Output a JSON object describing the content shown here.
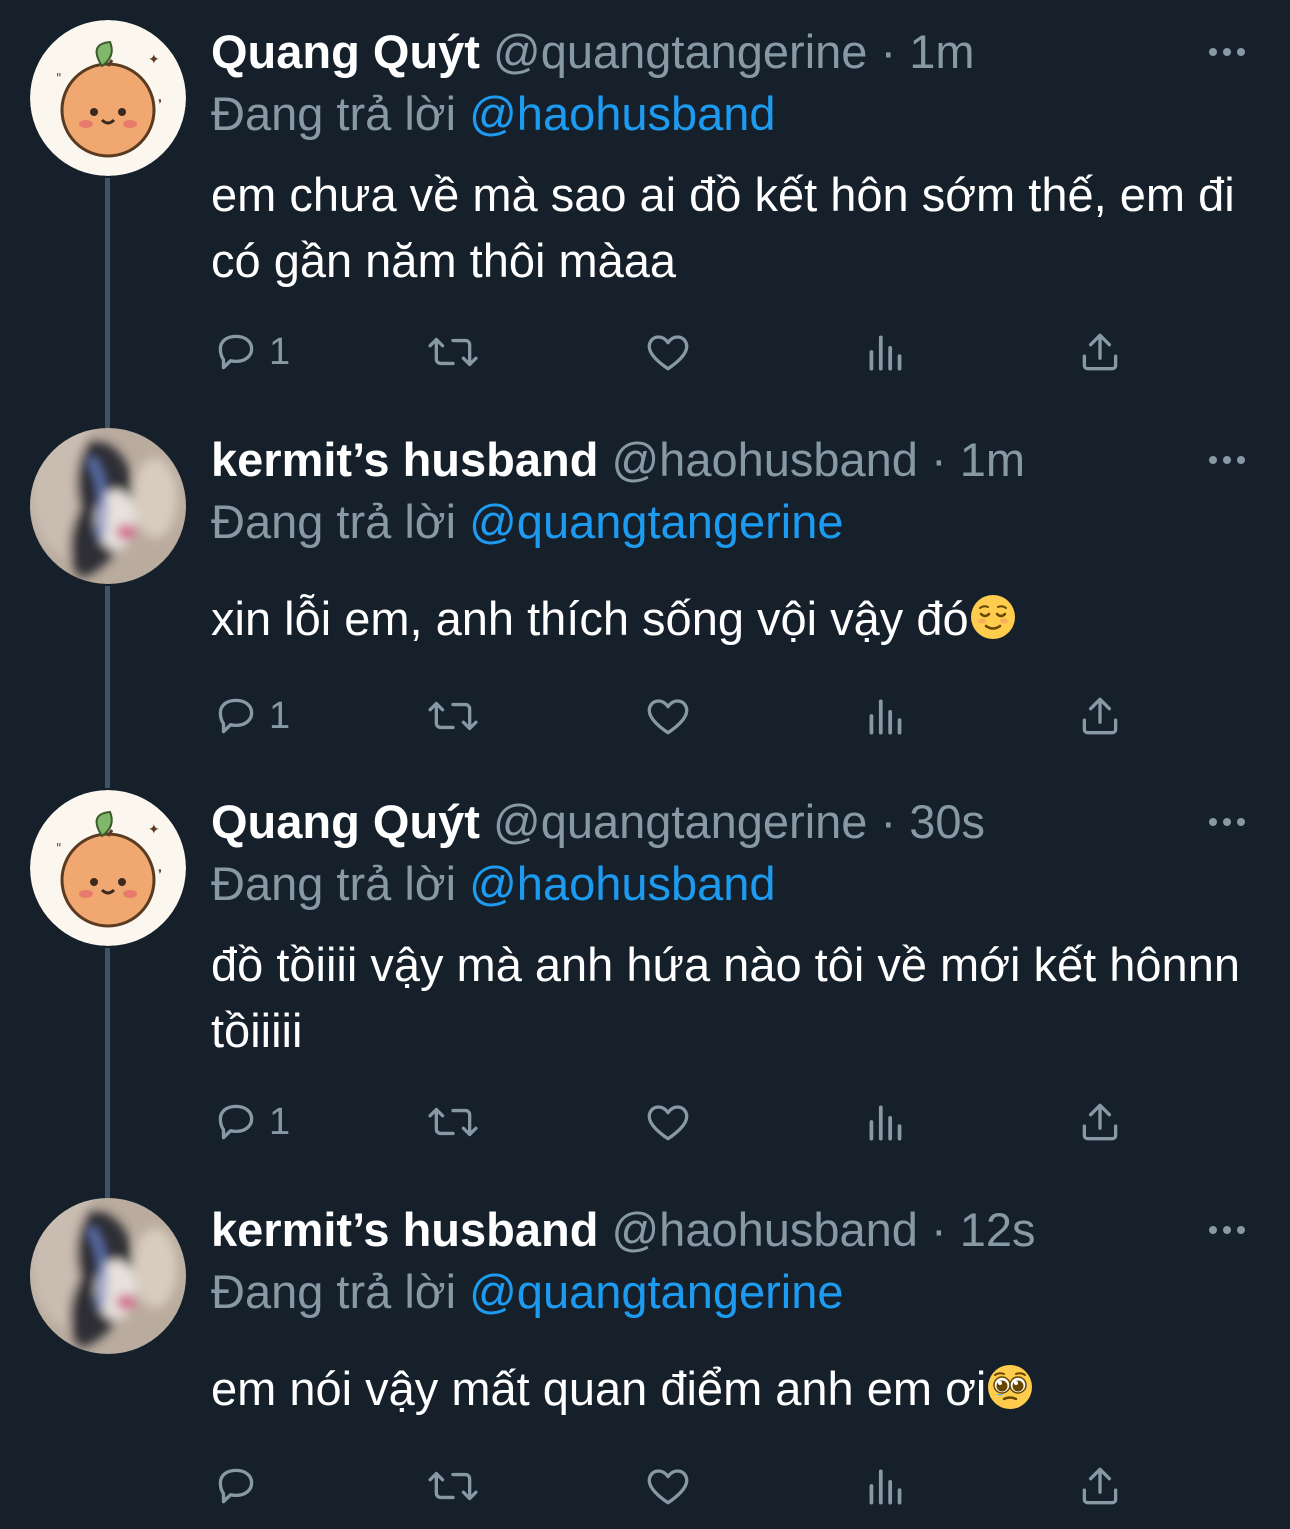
{
  "thread": [
    {
      "name": "Quang Quýt",
      "handle": "@quangtangerine",
      "separator": "·",
      "time": "1m",
      "replying_prefix": "Đang trả lời",
      "replying_to": "@haohusband",
      "text": "em chưa về mà sao ai đồ kết hôn sớm thế, em đi có gần năm thôi màaa",
      "reply_count": "1"
    },
    {
      "name": "kermit’s husband",
      "handle": "@haohusband",
      "separator": "·",
      "time": "1m",
      "replying_prefix": "Đang trả lời",
      "replying_to": "@quangtangerine",
      "text": "xin lỗi em, anh thích sống vội vậy đó",
      "reply_count": "1"
    },
    {
      "name": "Quang Quýt",
      "handle": "@quangtangerine",
      "separator": "·",
      "time": "30s",
      "replying_prefix": "Đang trả lời",
      "replying_to": "@haohusband",
      "text": "đồ tồiiii vậy mà anh hứa nào tôi về mới kết hônnn tồiiiii",
      "reply_count": "1"
    },
    {
      "name": "kermit’s husband",
      "handle": "@haohusband",
      "separator": "·",
      "time": "12s",
      "replying_prefix": "Đang trả lời",
      "replying_to": "@quangtangerine",
      "text": "em nói vậy mất quan điểm anh em ơi",
      "reply_count": ""
    }
  ],
  "emojis": [
    "relieved-face",
    "pleading-face"
  ],
  "colors": {
    "background": "#15202b",
    "text": "#ffffff",
    "secondary": "#8899a6",
    "accent": "#1d9bf0",
    "thread_line": "#3d5466"
  },
  "icons": [
    "reply-icon",
    "retweet-icon",
    "like-icon",
    "views-icon",
    "share-icon",
    "more-icon"
  ]
}
